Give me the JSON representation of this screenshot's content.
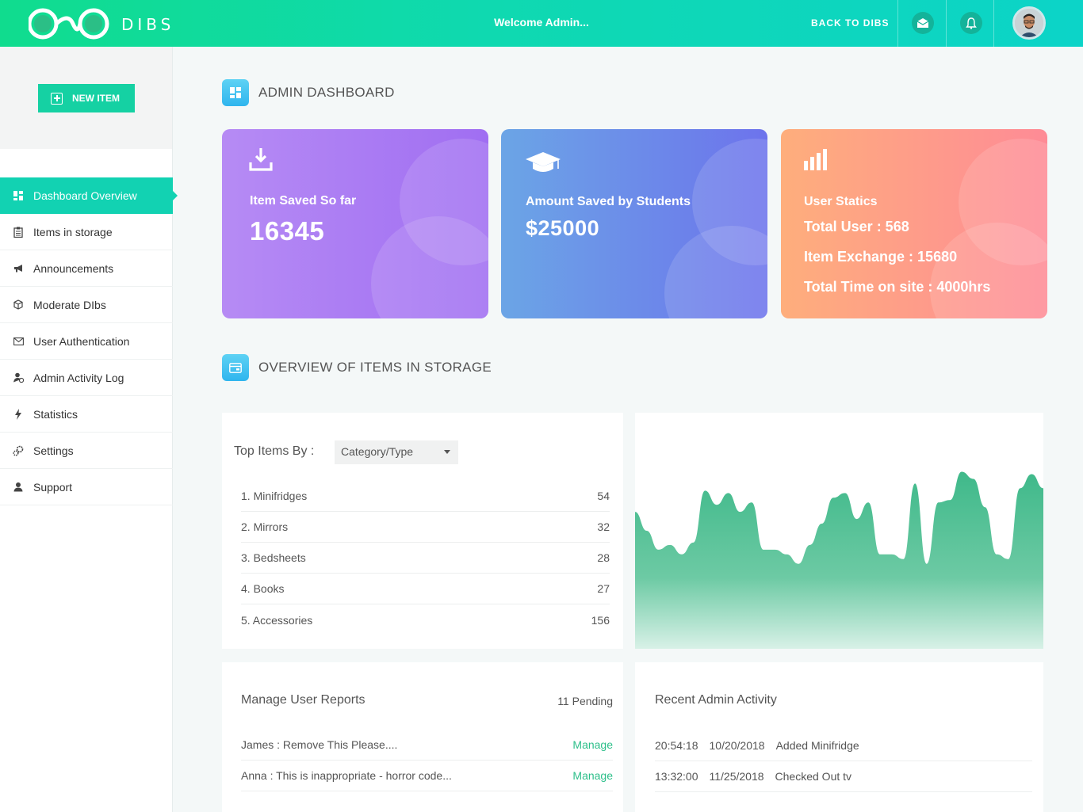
{
  "header": {
    "brand": "DIBS",
    "welcome": "Welcome Admin...",
    "back_link": "BACK TO DIBS"
  },
  "sidebar": {
    "new_item_label": "NEW ITEM",
    "items": [
      {
        "label": "Dashboard Overview",
        "icon": "grid-icon",
        "active": true
      },
      {
        "label": "Items in storage",
        "icon": "clipboard-icon"
      },
      {
        "label": "Announcements",
        "icon": "megaphone-icon"
      },
      {
        "label": "Moderate DIbs",
        "icon": "cube-icon"
      },
      {
        "label": "User Authentication",
        "icon": "mail-check-icon"
      },
      {
        "label": "Admin Activity Log",
        "icon": "user-clock-icon"
      },
      {
        "label": "Statistics",
        "icon": "bolt-icon"
      },
      {
        "label": "Settings",
        "icon": "gears-icon"
      },
      {
        "label": "Support",
        "icon": "support-icon"
      }
    ]
  },
  "dashboard": {
    "title": "ADMIN DASHBOARD",
    "cards": {
      "items_saved": {
        "label": "Item Saved So far",
        "value": "16345"
      },
      "amount_saved": {
        "label": "Amount Saved by Students",
        "value": "$25000"
      },
      "user_stats": {
        "label": "User Statics",
        "total_user": "Total User : 568",
        "item_exchange": "Item Exchange : 15680",
        "total_time": "Total Time on site : 4000hrs"
      }
    }
  },
  "storage": {
    "title": "OVERVIEW OF ITEMS IN STORAGE",
    "top_items_label": "Top Items By :",
    "selected_filter": "Category/Type",
    "items": [
      {
        "name": "1. Minifridges",
        "count": "54"
      },
      {
        "name": "2. Mirrors",
        "count": "32"
      },
      {
        "name": "3. Bedsheets",
        "count": "28"
      },
      {
        "name": "4. Books",
        "count": "27"
      },
      {
        "name": "5. Accessories",
        "count": "156"
      }
    ]
  },
  "chart_data": {
    "type": "area",
    "title": "",
    "xlabel": "",
    "ylabel": "",
    "values": [
      58,
      50,
      42,
      44,
      40,
      45,
      67,
      61,
      66,
      58,
      62,
      42,
      42,
      40,
      36,
      44,
      53,
      64,
      66,
      55,
      62,
      40,
      40,
      38,
      70,
      36,
      62,
      63,
      75,
      72,
      60,
      40,
      38,
      68,
      74,
      68
    ],
    "color": "#3fb98a"
  },
  "reports": {
    "title": "Manage User Reports",
    "pending": "11 Pending",
    "rows": [
      {
        "text": "James : Remove This Please....",
        "action": "Manage"
      },
      {
        "text": "Anna : This is inappropriate - horror code...",
        "action": "Manage"
      }
    ]
  },
  "activity": {
    "title": "Recent Admin Activity",
    "rows": [
      {
        "time": "20:54:18",
        "date": "10/20/2018",
        "action": "Added Minifridge"
      },
      {
        "time": "13:32:00",
        "date": "11/25/2018",
        "action": "Checked Out tv"
      }
    ]
  }
}
